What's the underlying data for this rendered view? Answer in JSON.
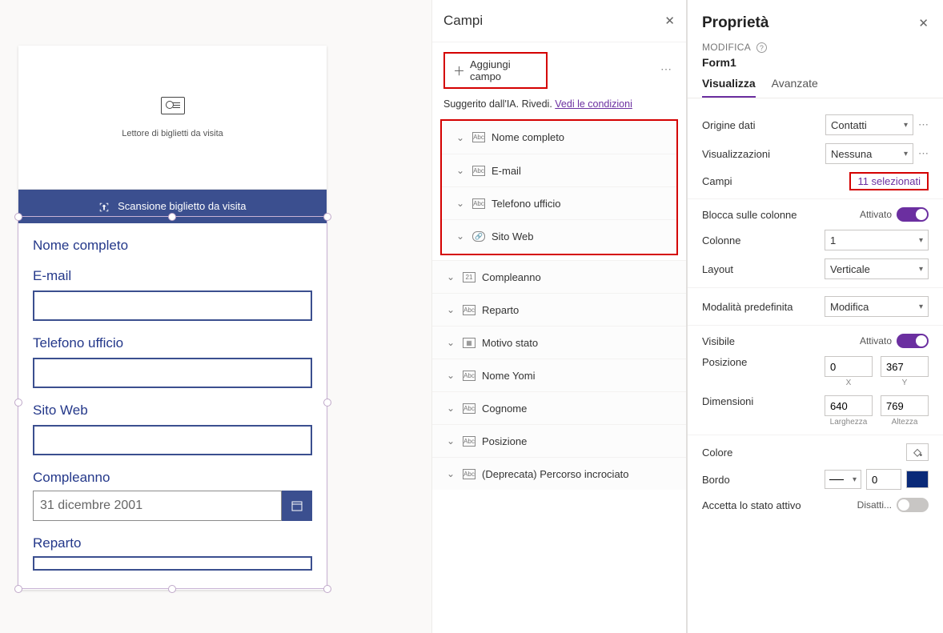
{
  "canvas": {
    "form": {
      "header_label": "Lettore di biglietti da visita",
      "scan_button": "Scansione biglietto da visita",
      "fields": {
        "full_name": "Nome completo",
        "email": "E-mail",
        "office_phone": "Telefono ufficio",
        "website": "Sito Web",
        "birthday_label": "Compleanno",
        "birthday_value": "31 dicembre 2001",
        "department": "Reparto"
      }
    }
  },
  "fields_panel": {
    "title": "Campi",
    "add_field": "Aggiungi campo",
    "suggest_prefix": "Suggerito dall'IA. Rivedi. ",
    "suggest_link": "Vedi le condizioni",
    "items_top": [
      {
        "label": "Nome completo",
        "icon": "Abc"
      },
      {
        "label": "E-mail",
        "icon": "Abc"
      },
      {
        "label": "Telefono ufficio",
        "icon": "Abc"
      },
      {
        "label": "Sito Web",
        "icon": "link"
      }
    ],
    "items_bottom": [
      {
        "label": "Compleanno",
        "icon": "21"
      },
      {
        "label": "Reparto",
        "icon": "Abc"
      },
      {
        "label": "Motivo stato",
        "icon": "opt"
      },
      {
        "label": "Nome Yomi",
        "icon": "Abc"
      },
      {
        "label": "Cognome",
        "icon": "Abc"
      },
      {
        "label": "Posizione",
        "icon": "Abc"
      },
      {
        "label": "(Deprecata) Percorso incrociato",
        "icon": "Abc"
      }
    ]
  },
  "props_panel": {
    "title": "Proprietà",
    "edit_label": "MODIFICA",
    "form_name": "Form1",
    "tabs": {
      "display": "Visualizza",
      "advanced": "Avanzate"
    },
    "rows": {
      "data_source_label": "Origine dati",
      "data_source_value": "Contatti",
      "views_label": "Visualizzazioni",
      "views_value": "Nessuna",
      "fields_label": "Campi",
      "fields_value": "11 selezionati",
      "snap_label": "Blocca sulle colonne",
      "snap_value": "Attivato",
      "cols_label": "Colonne",
      "cols_value": "1",
      "layout_label": "Layout",
      "layout_value": "Verticale",
      "mode_label": "Modalità predefinita",
      "mode_value": "Modifica",
      "visible_label": "Visibile",
      "visible_value": "Attivato",
      "pos_label": "Posizione",
      "pos_x": "0",
      "pos_y": "367",
      "pos_x_sub": "X",
      "pos_y_sub": "Y",
      "size_label": "Dimensioni",
      "size_w": "640",
      "size_h": "769",
      "size_w_sub": "Larghezza",
      "size_h_sub": "Altezza",
      "color_label": "Colore",
      "border_label": "Bordo",
      "border_value": "0",
      "focus_label": "Accetta lo stato attivo",
      "focus_value": "Disatti..."
    }
  }
}
